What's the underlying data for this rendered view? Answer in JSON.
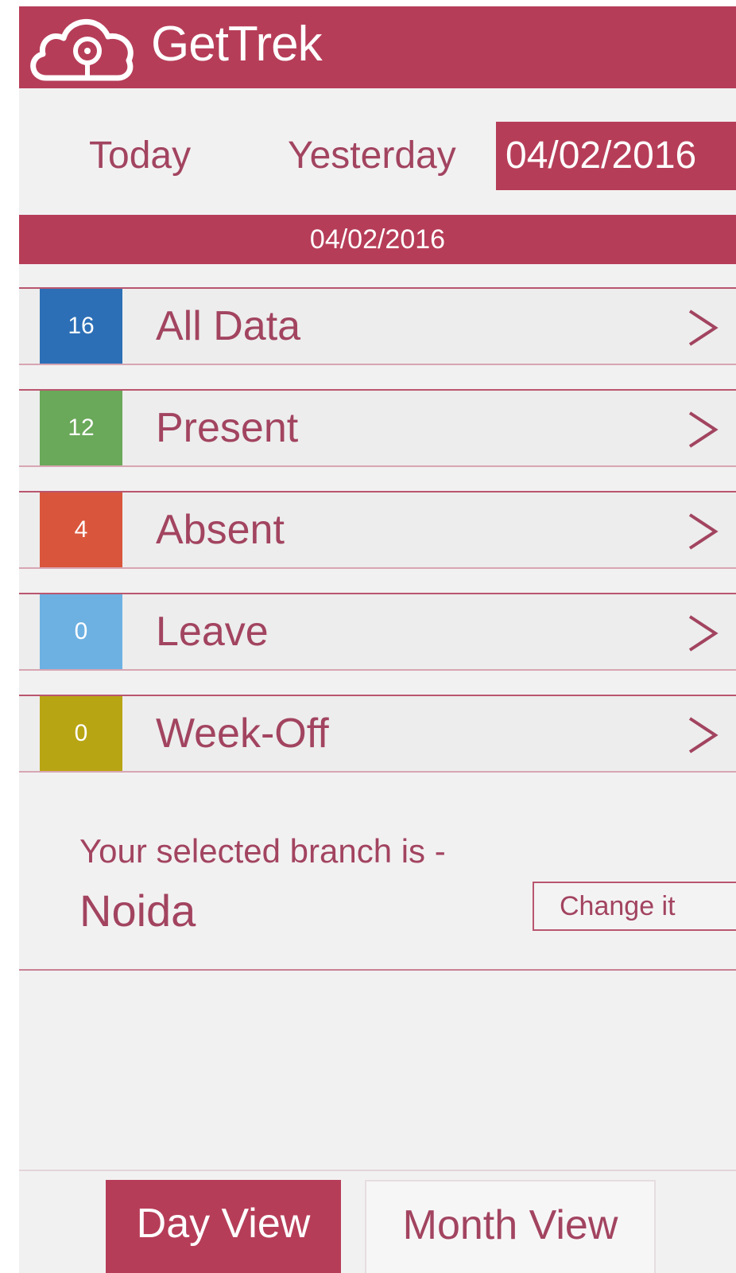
{
  "header": {
    "logo_icon": "cloud-location-icon",
    "title": "GetTrek"
  },
  "date_tabs": {
    "today": "Today",
    "yesterday": "Yesterday",
    "selected_date": "04/02/2016"
  },
  "date_bar": "04/02/2016",
  "rows": [
    {
      "count": "16",
      "label": "All Data",
      "color": "#2c6fb6"
    },
    {
      "count": "12",
      "label": "Present",
      "color": "#6aa85a"
    },
    {
      "count": "4",
      "label": "Absent",
      "color": "#d9563c"
    },
    {
      "count": "0",
      "label": "Leave",
      "color": "#6db1e2"
    },
    {
      "count": "0",
      "label": "Week-Off",
      "color": "#b8a514"
    }
  ],
  "branch": {
    "caption": "Your selected branch is -",
    "name": "Noida",
    "change_label": "Change it"
  },
  "views": {
    "day": "Day View",
    "month": "Month View"
  },
  "colors": {
    "brand": "#b63d58",
    "text": "#a24460",
    "background": "#f2f1f2"
  }
}
